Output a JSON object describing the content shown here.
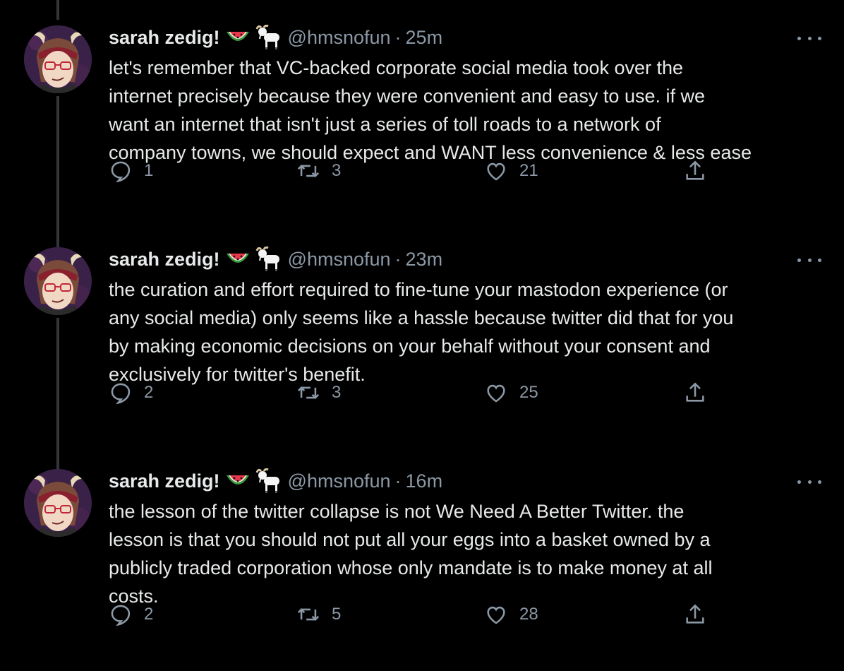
{
  "tweets": [
    {
      "name": "sarah zedig!",
      "handle": "@hmsnofun",
      "separator": "·",
      "time": "25m",
      "text": "let's remember that VC-backed corporate social media took over the\ninternet precisely because they were convenient and easy to use. if we\nwant an internet that isn't just a series of toll roads to a network of\ncompany towns, we should expect and WANT less convenience & less ease",
      "replies": "1",
      "retweets": "3",
      "likes": "21"
    },
    {
      "name": "sarah zedig!",
      "handle": "@hmsnofun",
      "separator": "·",
      "time": "23m",
      "text": "the curation and effort required to fine-tune your mastodon experience (or\nany social media) only seems like a hassle because twitter did that for you\nby making economic decisions on your behalf without your consent and\nexclusively for twitter's benefit.",
      "replies": "2",
      "retweets": "3",
      "likes": "25"
    },
    {
      "name": "sarah zedig!",
      "handle": "@hmsnofun",
      "separator": "·",
      "time": "16m",
      "text": "the lesson of the twitter collapse is not We Need A Better Twitter. the\nlesson is that you should not put all your eggs into a basket owned by a\npublicly traded corporation whose only mandate is to make money at all\ncosts.",
      "replies": "2",
      "retweets": "5",
      "likes": "28"
    }
  ],
  "icons": {
    "name_emojis": [
      "watermelon-icon",
      "goat-icon"
    ],
    "actions": [
      "reply-icon",
      "retweet-icon",
      "like-icon",
      "share-icon"
    ],
    "menu": "more-options-icon"
  },
  "colors": {
    "background": "#000000",
    "text": "#e7e9ea",
    "secondary": "#8b98a5",
    "thread_line": "#333639"
  }
}
